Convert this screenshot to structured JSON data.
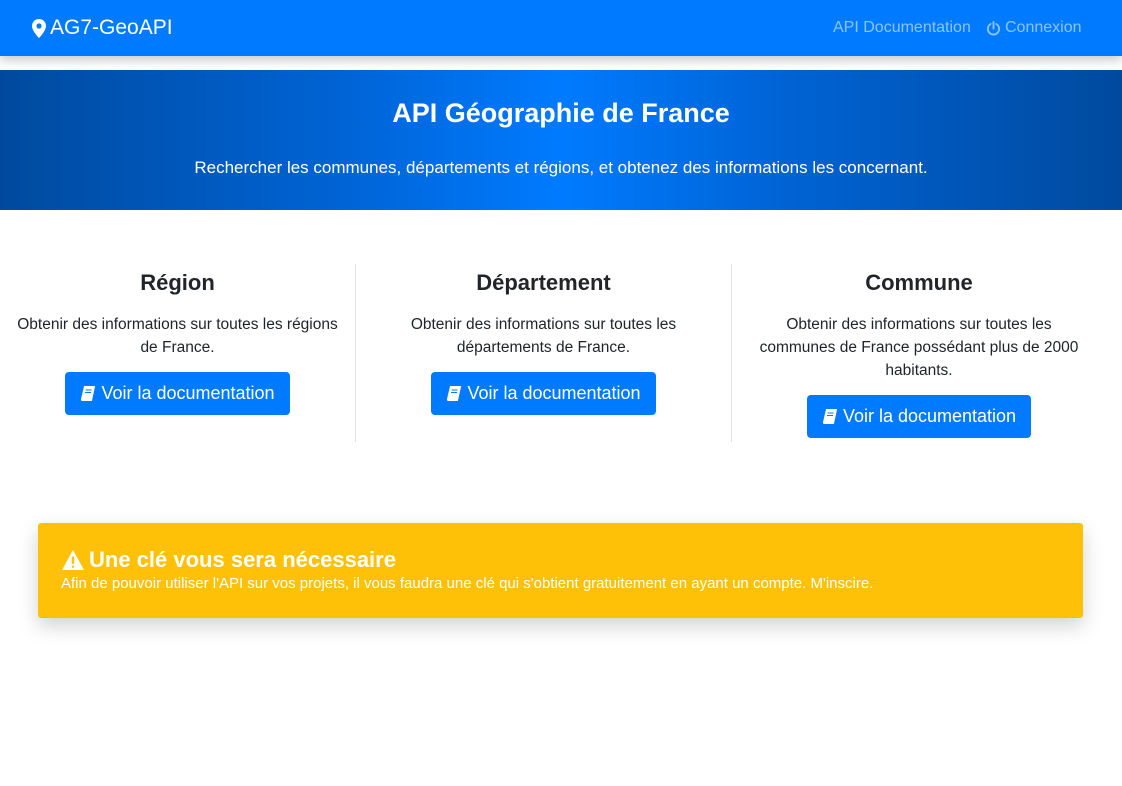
{
  "navbar": {
    "brand": "AG7-GeoAPI",
    "links": [
      {
        "label": "API Documentation"
      },
      {
        "label": "Connexion"
      }
    ]
  },
  "hero": {
    "title": "API Géographie de France",
    "subtitle": "Rechercher les communes, départements et régions, et obtenez des informations les concernant."
  },
  "cards": [
    {
      "title": "Région",
      "description": "Obtenir des informations sur toutes les régions de France.",
      "button": "Voir la documentation"
    },
    {
      "title": "Département",
      "description": "Obtenir des informations sur toutes les départements de France.",
      "button": "Voir la documentation"
    },
    {
      "title": "Commune",
      "description": "Obtenir des informations sur toutes les communes de France possédant plus de 2000 habitants.",
      "button": "Voir la documentation"
    }
  ],
  "alert": {
    "title": "Une clé vous sera nécessaire",
    "text": "Afin de pouvoir utiliser l'API sur vos projets, il vous faudra une clé qui s'obtient gratuitement en ayant un compte. M'inscire."
  },
  "colors": {
    "primary": "#007bff",
    "warning": "#ffc107",
    "hero_dark": "#004a9e"
  },
  "icons": {
    "brand": "map-marker-icon",
    "login": "power-icon",
    "doc_button": "book-icon",
    "alert": "warning-icon"
  }
}
